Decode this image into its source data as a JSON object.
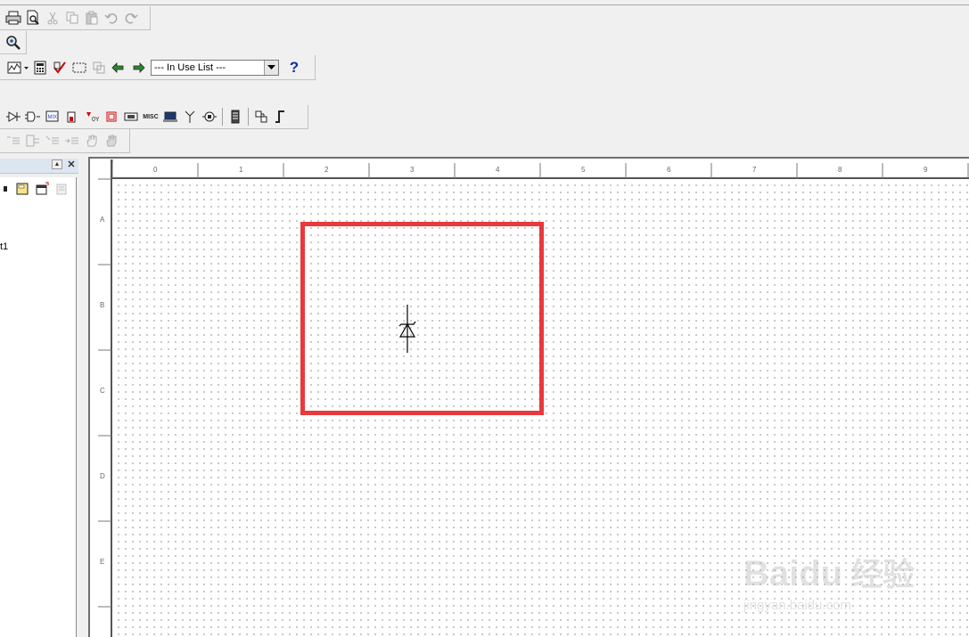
{
  "toolbar_standard": {
    "items": [
      "print-icon",
      "print-preview-icon",
      "cut-icon",
      "copy-icon",
      "paste-icon",
      "undo-icon",
      "redo-icon"
    ]
  },
  "toolbar_zoom": {
    "items": [
      "zoom-area-icon"
    ]
  },
  "toolbar_simulation": {
    "in_use_list": {
      "value": "--- In Use List ---"
    },
    "help_label": "?"
  },
  "toolbar_components": {
    "items": [
      "source-component-icon",
      "basic-component-icon",
      "diode-component-icon",
      "transistor-component-icon",
      "analog-component-icon",
      "ttl-component-icon",
      "cmos-component-icon",
      "mcu-component-icon",
      "misc-digital-icon",
      "indicator-component-icon",
      "antenna-rf-icon",
      "electromechanical-icon",
      "place-bus-icon",
      "hierarchical-block-icon",
      "place-wire-icon"
    ],
    "misc_label": "MISC"
  },
  "toolbar_graphic": {
    "items": [
      "graphic-tool-1-icon",
      "graphic-tool-2-icon",
      "graphic-tool-3-icon",
      "graphic-tool-4-icon",
      "pan-hand-icon",
      "pan-hand-2-icon"
    ]
  },
  "design_toolbox": {
    "tree_item": "t1",
    "minimize_label": "▲",
    "close_label": "✕"
  },
  "ruler": {
    "columns": [
      "0",
      "1",
      "2",
      "3",
      "4",
      "5",
      "6",
      "7",
      "8",
      "9"
    ],
    "rows": [
      "A",
      "B",
      "C",
      "D",
      "E"
    ]
  },
  "canvas": {
    "highlight_color": "#e8393c",
    "component": "zener-diode-icon"
  },
  "watermark": {
    "brand": "Baidu",
    "chinese": "经验",
    "url": "jingyan.baidu.com"
  }
}
